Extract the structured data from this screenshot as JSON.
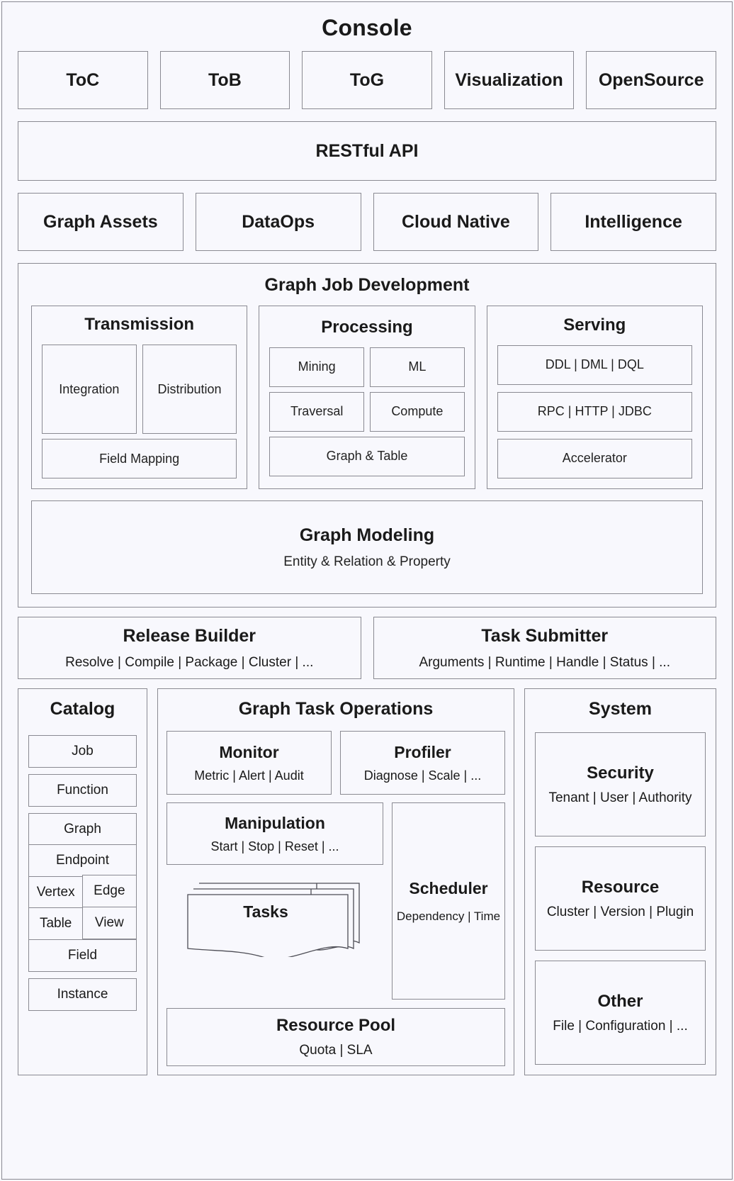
{
  "title": "Console",
  "channels": [
    {
      "label": "ToC"
    },
    {
      "label": "ToB"
    },
    {
      "label": "ToG"
    },
    {
      "label": "Visualization"
    },
    {
      "label": "OpenSource"
    }
  ],
  "api": {
    "label": "RESTful API"
  },
  "capabilities": [
    {
      "label": "Graph Assets"
    },
    {
      "label": "DataOps"
    },
    {
      "label": "Cloud Native"
    },
    {
      "label": "Intelligence"
    }
  ],
  "graph_job_development": {
    "title": "Graph Job Development",
    "transmission": {
      "title": "Transmission",
      "pair": [
        "Integration",
        "Distribution"
      ],
      "wide": "Field Mapping"
    },
    "processing": {
      "title": "Processing",
      "row1": [
        "Mining",
        "ML"
      ],
      "row2": [
        "Traversal",
        "Compute"
      ],
      "wide": "Graph & Table"
    },
    "serving": {
      "title": "Serving",
      "items": [
        "DDL | DML | DQL",
        "RPC | HTTP | JDBC",
        "Accelerator"
      ]
    },
    "graph_modeling": {
      "title": "Graph Modeling",
      "subtitle": "Entity & Relation & Property"
    }
  },
  "release_builder": {
    "title": "Release Builder",
    "subtitle": "Resolve | Compile | Package | Cluster | ..."
  },
  "task_submitter": {
    "title": "Task Submitter",
    "subtitle": "Arguments | Runtime | Handle | Status | ..."
  },
  "catalog": {
    "title": "Catalog",
    "job": "Job",
    "function": "Function",
    "graph": "Graph",
    "endpoint": "Endpoint",
    "vertex": "Vertex",
    "edge": "Edge",
    "table": "Table",
    "view": "View",
    "field": "Field",
    "instance": "Instance"
  },
  "graph_task_operations": {
    "title": "Graph Task Operations",
    "monitor": {
      "title": "Monitor",
      "subtitle": "Metric | Alert | Audit"
    },
    "profiler": {
      "title": "Profiler",
      "subtitle": "Diagnose | Scale | ..."
    },
    "manipulation": {
      "title": "Manipulation",
      "subtitle": "Start | Stop | Reset | ..."
    },
    "tasks": {
      "title": "Tasks"
    },
    "scheduler": {
      "title": "Scheduler",
      "subtitle": "Dependency | Time"
    },
    "resource_pool": {
      "title": "Resource Pool",
      "subtitle": "Quota | SLA"
    }
  },
  "system": {
    "title": "System",
    "security": {
      "title": "Security",
      "subtitle": "Tenant | User | Authority"
    },
    "resource": {
      "title": "Resource",
      "subtitle": "Cluster | Version | Plugin"
    },
    "other": {
      "title": "Other",
      "subtitle": "File | Configuration | ..."
    }
  },
  "colors": {
    "background": "#f7f7fc",
    "panel": "#f8f8fd",
    "border": "#8a8a92",
    "text": "#1a1a1a"
  }
}
